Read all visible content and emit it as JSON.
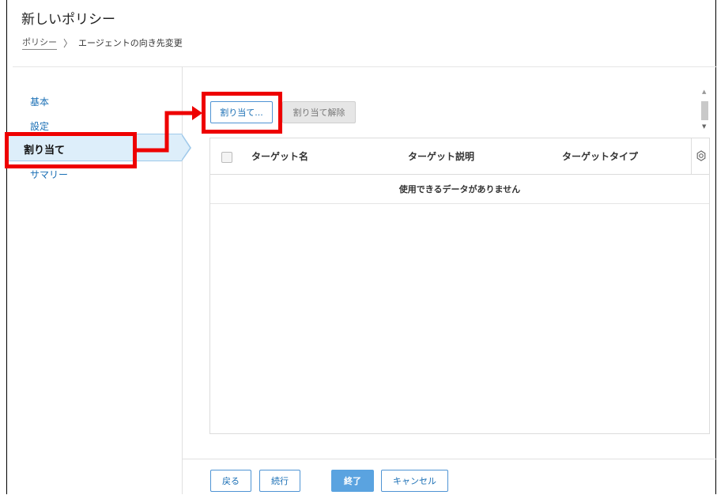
{
  "header": {
    "title": "新しいポリシー",
    "breadcrumb": {
      "root": "ポリシー",
      "separator": "〉",
      "current": "エージェントの向き先変更"
    }
  },
  "sidebar": {
    "items": [
      {
        "label": "基本",
        "active": false
      },
      {
        "label": "設定",
        "active": false
      },
      {
        "label": "割り当て",
        "active": true
      },
      {
        "label": "サマリー",
        "active": false
      }
    ]
  },
  "toolbar": {
    "assign_label": "割り当て...",
    "unassign_label": "割り当て解除"
  },
  "table": {
    "columns": [
      "ターゲット名",
      "ターゲット説明",
      "ターゲットタイプ"
    ],
    "settings_icon": "gear-icon",
    "rows": [],
    "empty_message": "使用できるデータがありません"
  },
  "footer": {
    "back_label": "戻る",
    "next_label": "続行",
    "finish_label": "終了",
    "cancel_label": "キャンセル"
  },
  "colors": {
    "accent": "#1a6fb5",
    "active_nav_bg": "#ddeefa",
    "primary_button": "#5aa3e0",
    "annotation_red": "#ee0000"
  }
}
